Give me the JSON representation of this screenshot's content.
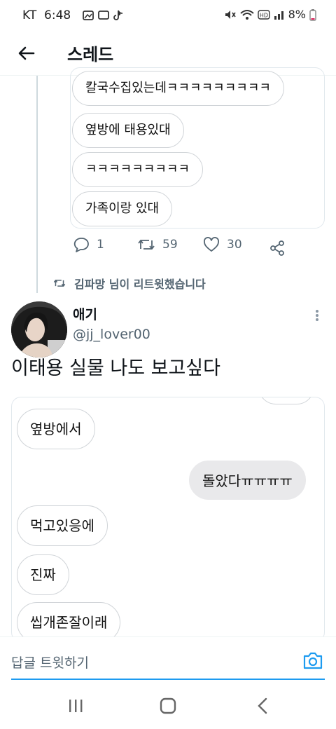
{
  "status_bar": {
    "carrier": "KT",
    "time": "6:48",
    "battery": "8%",
    "notification_dot": "•"
  },
  "header": {
    "title": "스레드"
  },
  "quoted_chat_top": {
    "messages": [
      {
        "text": "칼국수집있는데ㅋㅋㅋㅋㅋㅋㅋㅋㅋ",
        "from": "other"
      },
      {
        "text": "옆방에 태용있대",
        "from": "other"
      },
      {
        "text": "ㅋㅋㅋㅋㅋㅋㅋㅋㅋ",
        "from": "other"
      },
      {
        "text": "가족이랑 있대",
        "from": "other"
      }
    ]
  },
  "tweet_actions": {
    "replies": "1",
    "retweets": "59",
    "likes": "30"
  },
  "retweet_notice": "김파망 님이 리트윗했습니다",
  "tweet": {
    "display_name": "애기",
    "handle": "@jj_lover00",
    "text": "이태용 실물 나도 보고싶다"
  },
  "quoted_chat_bottom": {
    "messages": [
      {
        "text": "옆방에서",
        "from": "other"
      },
      {
        "text": "돌았다ㅠㅠㅠㅠ",
        "from": "me"
      },
      {
        "text": "먹고있응에",
        "from": "other"
      },
      {
        "text": "진짜",
        "from": "other"
      },
      {
        "text": "씹개존잘이래",
        "from": "other"
      }
    ]
  },
  "reply_bar": {
    "placeholder": "답글 트윗하기"
  },
  "colors": {
    "accent": "#1d9bf0",
    "secondary_text": "#536471",
    "border": "#e1e8ed",
    "my_bubble": "#e9e9eb"
  },
  "icons": {
    "back": "arrow-left-icon",
    "reply": "comment-icon",
    "retweet": "retweet-icon",
    "like": "heart-icon",
    "share": "share-icon",
    "more": "more-vertical-icon",
    "camera": "camera-icon"
  }
}
